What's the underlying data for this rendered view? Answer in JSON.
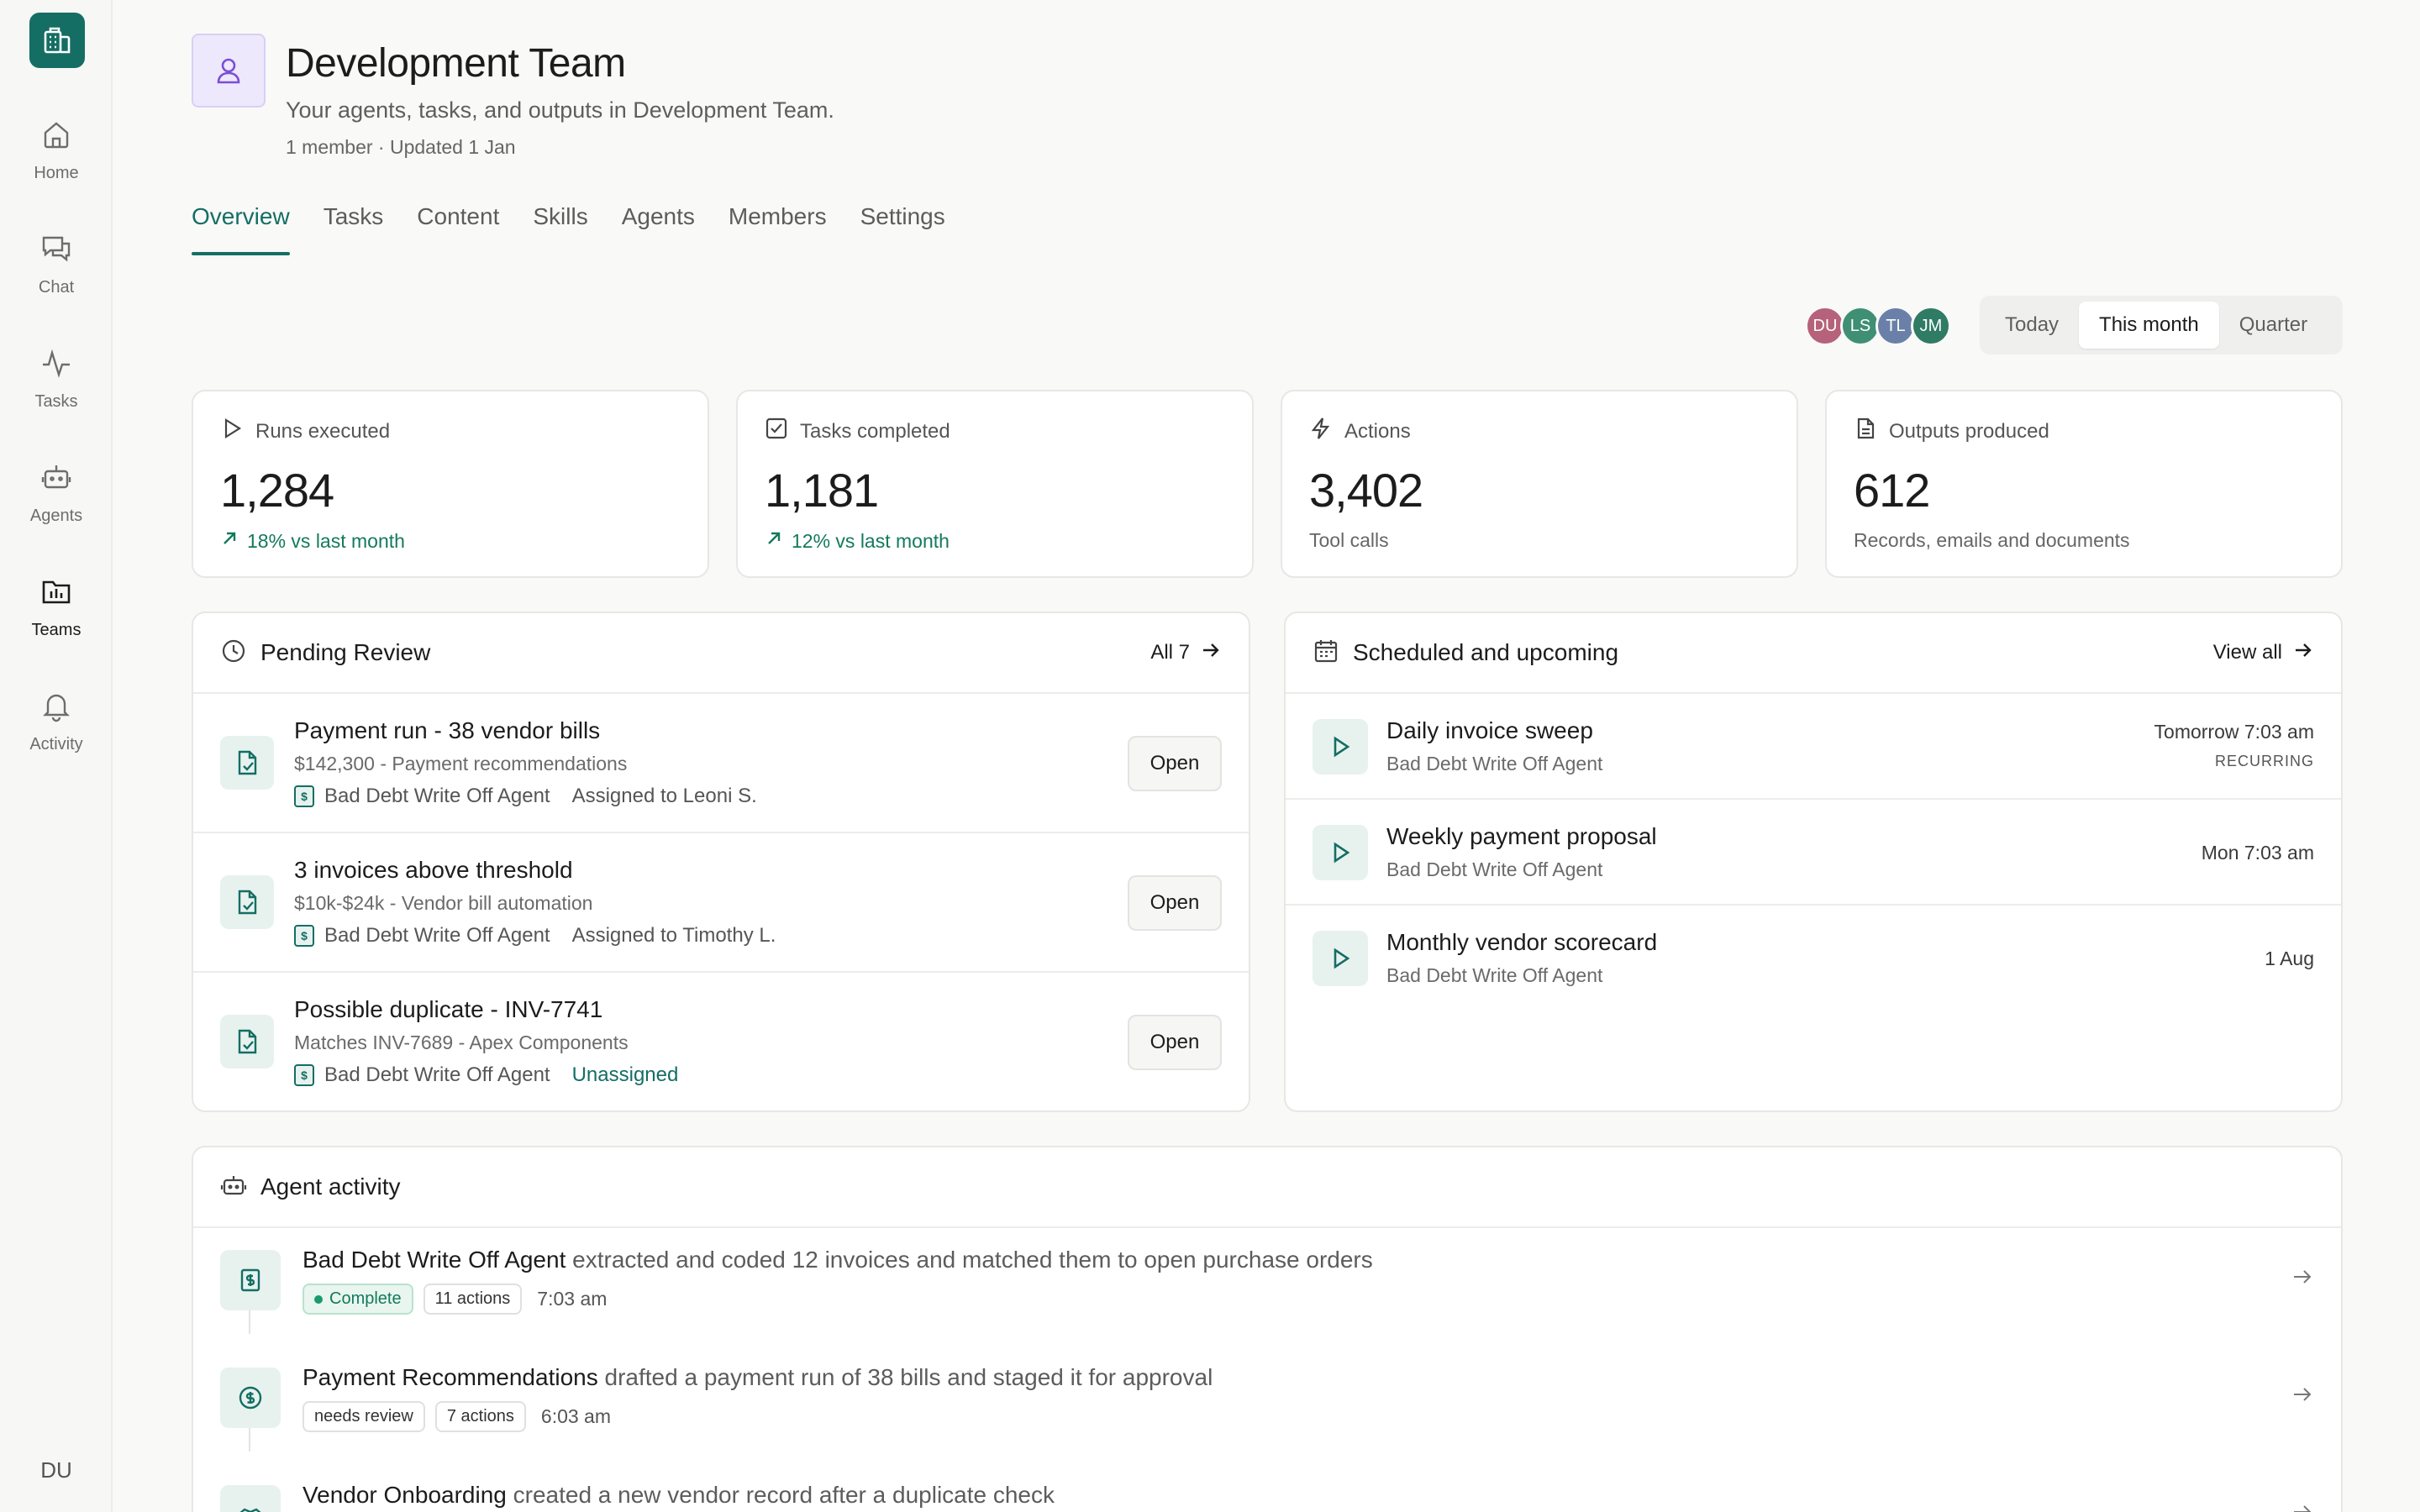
{
  "rail": {
    "items": [
      {
        "label": "Home",
        "icon": "home-icon"
      },
      {
        "label": "Chat",
        "icon": "chat-icon"
      },
      {
        "label": "Tasks",
        "icon": "activity-pulse-icon"
      },
      {
        "label": "Agents",
        "icon": "robot-icon"
      },
      {
        "label": "Teams",
        "icon": "teams-icon"
      },
      {
        "label": "Activity",
        "icon": "bell-icon"
      }
    ],
    "active": "Teams",
    "user_initials": "DU"
  },
  "header": {
    "title": "Development Team",
    "subtitle": "Your agents, tasks, and outputs in Development Team.",
    "meta": "1 member · Updated 1 Jan"
  },
  "tabs": [
    "Overview",
    "Tasks",
    "Content",
    "Skills",
    "Agents",
    "Members",
    "Settings"
  ],
  "active_tab": "Overview",
  "avatars": [
    {
      "initials": "DU",
      "color": "#b5627a"
    },
    {
      "initials": "LS",
      "color": "#3f8f74"
    },
    {
      "initials": "TL",
      "color": "#6a80a8"
    },
    {
      "initials": "JM",
      "color": "#2f7b63"
    }
  ],
  "range": {
    "options": [
      "Today",
      "This month",
      "Quarter"
    ],
    "selected": "This month"
  },
  "stats": [
    {
      "label": "Runs executed",
      "value": "1,284",
      "foot": "18% vs last month",
      "trend": "up",
      "icon": "play-outline-icon"
    },
    {
      "label": "Tasks completed",
      "value": "1,181",
      "foot": "12% vs last month",
      "trend": "up",
      "icon": "checkbox-icon"
    },
    {
      "label": "Actions",
      "value": "3,402",
      "foot": "Tool calls",
      "trend": "none",
      "icon": "lightning-icon"
    },
    {
      "label": "Outputs produced",
      "value": "612",
      "foot": "Records, emails and documents",
      "trend": "none",
      "icon": "document-icon"
    }
  ],
  "pending": {
    "title": "Pending Review",
    "link": "All 7",
    "items": [
      {
        "title": "Payment run - 38 vendor bills",
        "sub": "$142,300 - Payment recommendations",
        "agent": "Bad Debt Write Off Agent",
        "assign": "Assigned to Leoni S.",
        "button": "Open"
      },
      {
        "title": "3 invoices above threshold",
        "sub": "$10k-$24k - Vendor bill automation",
        "agent": "Bad Debt Write Off Agent",
        "assign": "Assigned to Timothy L.",
        "button": "Open"
      },
      {
        "title": "Possible duplicate - INV-7741",
        "sub": "Matches INV-7689 - Apex Components",
        "agent": "Bad Debt Write Off Agent",
        "assign": "Unassigned",
        "button": "Open"
      }
    ]
  },
  "scheduled": {
    "title": "Scheduled and upcoming",
    "link": "View all",
    "items": [
      {
        "title": "Daily invoice sweep",
        "sub": "Bad Debt Write Off Agent",
        "time": "Tomorrow 7:03 am",
        "tag": "RECURRING"
      },
      {
        "title": "Weekly payment proposal",
        "sub": "Bad Debt Write Off Agent",
        "time": "Mon 7:03 am",
        "tag": ""
      },
      {
        "title": "Monthly vendor scorecard",
        "sub": "Bad Debt Write Off Agent",
        "time": "1 Aug",
        "tag": ""
      }
    ]
  },
  "activity": {
    "title": "Agent activity",
    "items": [
      {
        "who": "Bad Debt Write Off Agent",
        "text": " extracted and coded 12 invoices and matched them to open purchase orders",
        "status": "Complete",
        "actions": "11 actions",
        "time": "7:03 am",
        "icon": "ledger-icon"
      },
      {
        "who": "Payment Recommendations",
        "text": " drafted a payment run of 38 bills and staged it for approval",
        "status": "needs review",
        "actions": "7 actions",
        "time": "6:03 am",
        "icon": "dollar-icon"
      },
      {
        "who": "Vendor Onboarding",
        "text": " created a new vendor record after a duplicate check",
        "status": "",
        "actions": "",
        "time": "",
        "icon": "handshake-icon"
      }
    ]
  },
  "colors": {
    "accent": "#146e64",
    "positive": "#137a5c",
    "team_icon_bg": "#ede8fb"
  }
}
